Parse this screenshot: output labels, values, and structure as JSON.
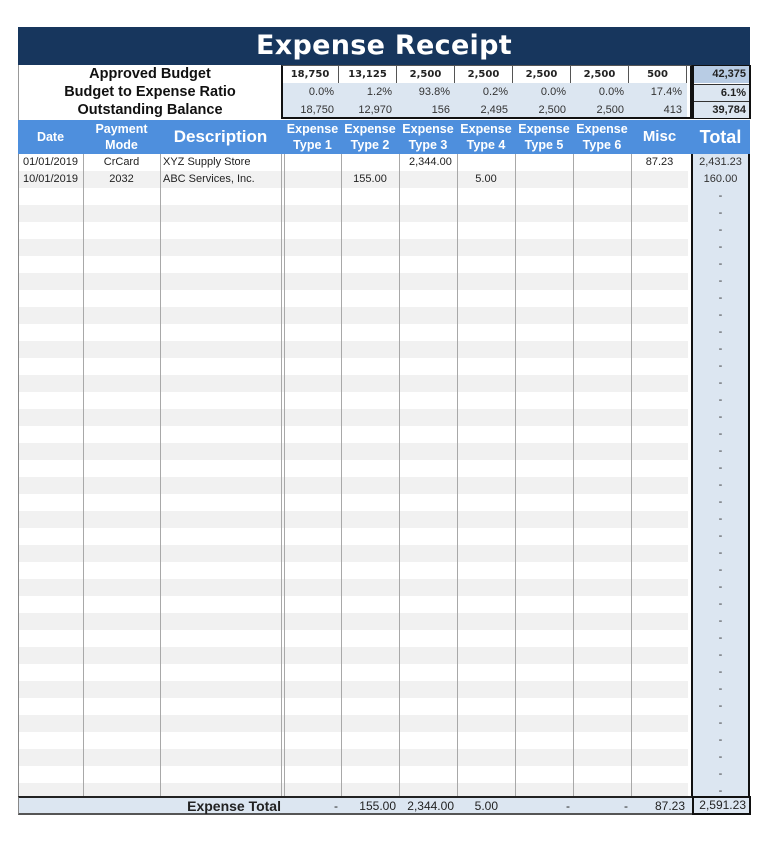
{
  "title": "Expense Receipt",
  "summary": {
    "labels": [
      "Approved Budget",
      "Budget to Expense Ratio",
      "Outstanding Balance"
    ],
    "approved_budget": [
      "18,750",
      "13,125",
      "2,500",
      "2,500",
      "2,500",
      "2,500",
      "500"
    ],
    "approved_budget_total": "42,375",
    "ratio": [
      "0.0%",
      "1.2%",
      "93.8%",
      "0.2%",
      "0.0%",
      "0.0%",
      "17.4%"
    ],
    "ratio_total": "6.1%",
    "outstanding": [
      "18,750",
      "12,970",
      "156",
      "2,495",
      "2,500",
      "2,500",
      "413"
    ],
    "outstanding_total": "39,784"
  },
  "columns": {
    "date": "Date",
    "payment_1": "Payment",
    "payment_2": "Mode",
    "description": "Description",
    "et1_1": "Expense",
    "et1_2": "Type 1",
    "et2_1": "Expense",
    "et2_2": "Type 2",
    "et3_1": "Expense",
    "et3_2": "Type 3",
    "et4_1": "Expense",
    "et4_2": "Type 4",
    "et5_1": "Expense",
    "et5_2": "Type 5",
    "et6_1": "Expense",
    "et6_2": "Type 6",
    "misc": "Misc",
    "total": "Total"
  },
  "rows": [
    {
      "date": "01/01/2019",
      "mode": "CrCard",
      "description": "XYZ Supply Store",
      "et1": "",
      "et2": "",
      "et3": "2,344.00",
      "et4": "",
      "et5": "",
      "et6": "",
      "misc": "87.23",
      "total": "2,431.23"
    },
    {
      "date": "10/01/2019",
      "mode": "2032",
      "description": "ABC Services, Inc.",
      "et1": "",
      "et2": "155.00",
      "et3": "",
      "et4": "5.00",
      "et5": "",
      "et6": "",
      "misc": "",
      "total": "160.00"
    }
  ],
  "empty_row_total": "-",
  "empty_row_count": 36,
  "footer": {
    "label": "Expense Total",
    "et1": "-",
    "et2": "155.00",
    "et3": "2,344.00",
    "et4": "5.00",
    "et5": "-",
    "et6": "-",
    "misc": "87.23",
    "total": "2,591.23"
  }
}
